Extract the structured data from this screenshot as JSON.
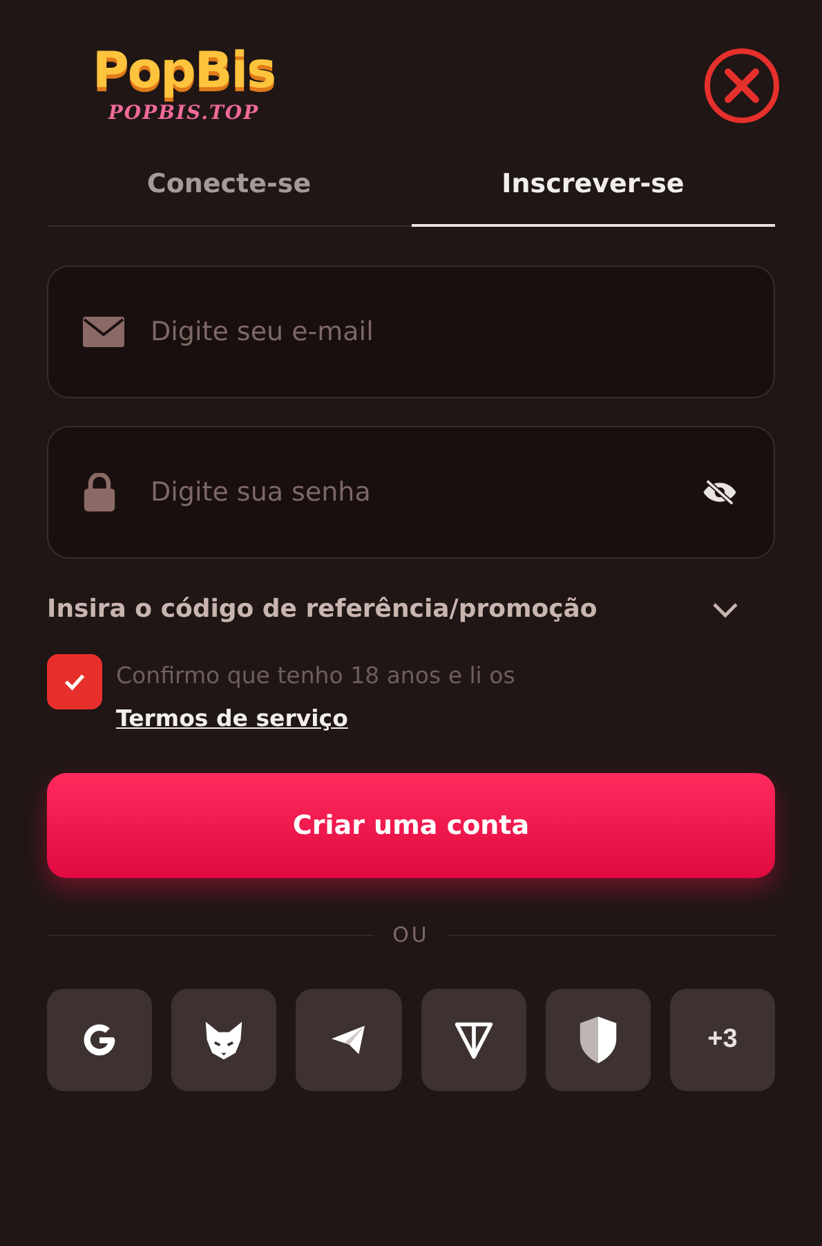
{
  "logo": {
    "title": "PopBis",
    "subtitle": "POPBIS.TOP"
  },
  "tabs": [
    {
      "label": "Conecte-se",
      "selected": false
    },
    {
      "label": "Inscrever-se",
      "selected": true
    }
  ],
  "email": {
    "placeholder": "Digite seu e-mail"
  },
  "password": {
    "placeholder": "Digite sua senha"
  },
  "referral": {
    "label": "Insira o código de referência/promoção",
    "expanded": false
  },
  "terms": {
    "checked": true,
    "text": "Confirmo que tenho 18 anos e li os ",
    "link": "Termos de serviço"
  },
  "submit": "Criar uma conta",
  "divider": "OU",
  "social": [
    {
      "kind": "google"
    },
    {
      "kind": "fox"
    },
    {
      "kind": "plane"
    },
    {
      "kind": "ton"
    },
    {
      "kind": "shield"
    },
    {
      "kind": "more",
      "label": "+3"
    }
  ]
}
